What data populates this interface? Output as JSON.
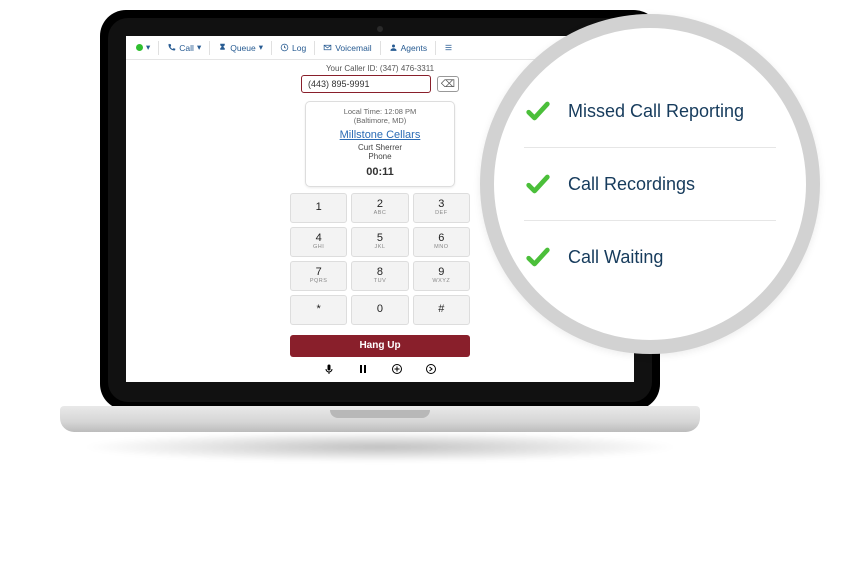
{
  "toolbar": {
    "status": "online",
    "call": "Call",
    "queue": "Queue",
    "log": "Log",
    "voicemail": "Voicemail",
    "agents": "Agents"
  },
  "callerId": {
    "label": "Your Caller ID:",
    "value": "(347) 476-3311"
  },
  "dialInput": {
    "value": "(443) 895-9991"
  },
  "card": {
    "localTimeLabel": "Local Time:",
    "localTimeValue": "12:08 PM",
    "location": "(Baltimore, MD)",
    "company": "Millstone Cellars",
    "contactName": "Curt Sherrer",
    "contactType": "Phone",
    "timer": "00:11"
  },
  "keypad": [
    {
      "n": "1",
      "l": ""
    },
    {
      "n": "2",
      "l": "ABC"
    },
    {
      "n": "3",
      "l": "DEF"
    },
    {
      "n": "4",
      "l": "GHI"
    },
    {
      "n": "5",
      "l": "JKL"
    },
    {
      "n": "6",
      "l": "MNO"
    },
    {
      "n": "7",
      "l": "PQRS"
    },
    {
      "n": "8",
      "l": "TUV"
    },
    {
      "n": "9",
      "l": "WXYZ"
    },
    {
      "n": "*",
      "l": ""
    },
    {
      "n": "0",
      "l": ""
    },
    {
      "n": "#",
      "l": ""
    }
  ],
  "hangup": "Hang Up",
  "features": [
    "Missed Call Reporting",
    "Call Recordings",
    "Call Waiting"
  ]
}
